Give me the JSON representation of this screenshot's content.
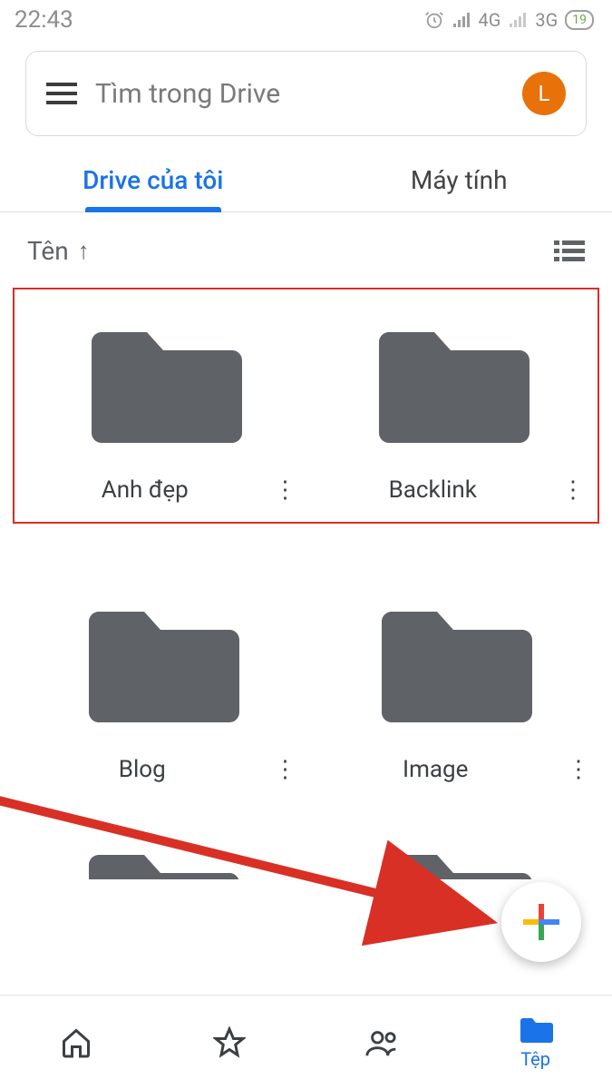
{
  "status": {
    "time": "22:43",
    "network1": "4G",
    "network2": "3G",
    "battery": "19"
  },
  "search": {
    "placeholder": "Tìm trong Drive",
    "avatar_letter": "L"
  },
  "tabs": [
    {
      "label": "Drive của tôi",
      "active": true
    },
    {
      "label": "Máy tính",
      "active": false
    }
  ],
  "sort": {
    "label": "Tên",
    "direction_icon": "↑"
  },
  "folders": [
    {
      "name": "Anh đẹp"
    },
    {
      "name": "Backlink"
    },
    {
      "name": "Blog"
    },
    {
      "name": "Image"
    }
  ],
  "bottom_nav": {
    "files_label": "Tệp"
  },
  "colors": {
    "accent": "#1a73e8",
    "highlight_border": "#d93025",
    "avatar_bg": "#e8710a"
  }
}
